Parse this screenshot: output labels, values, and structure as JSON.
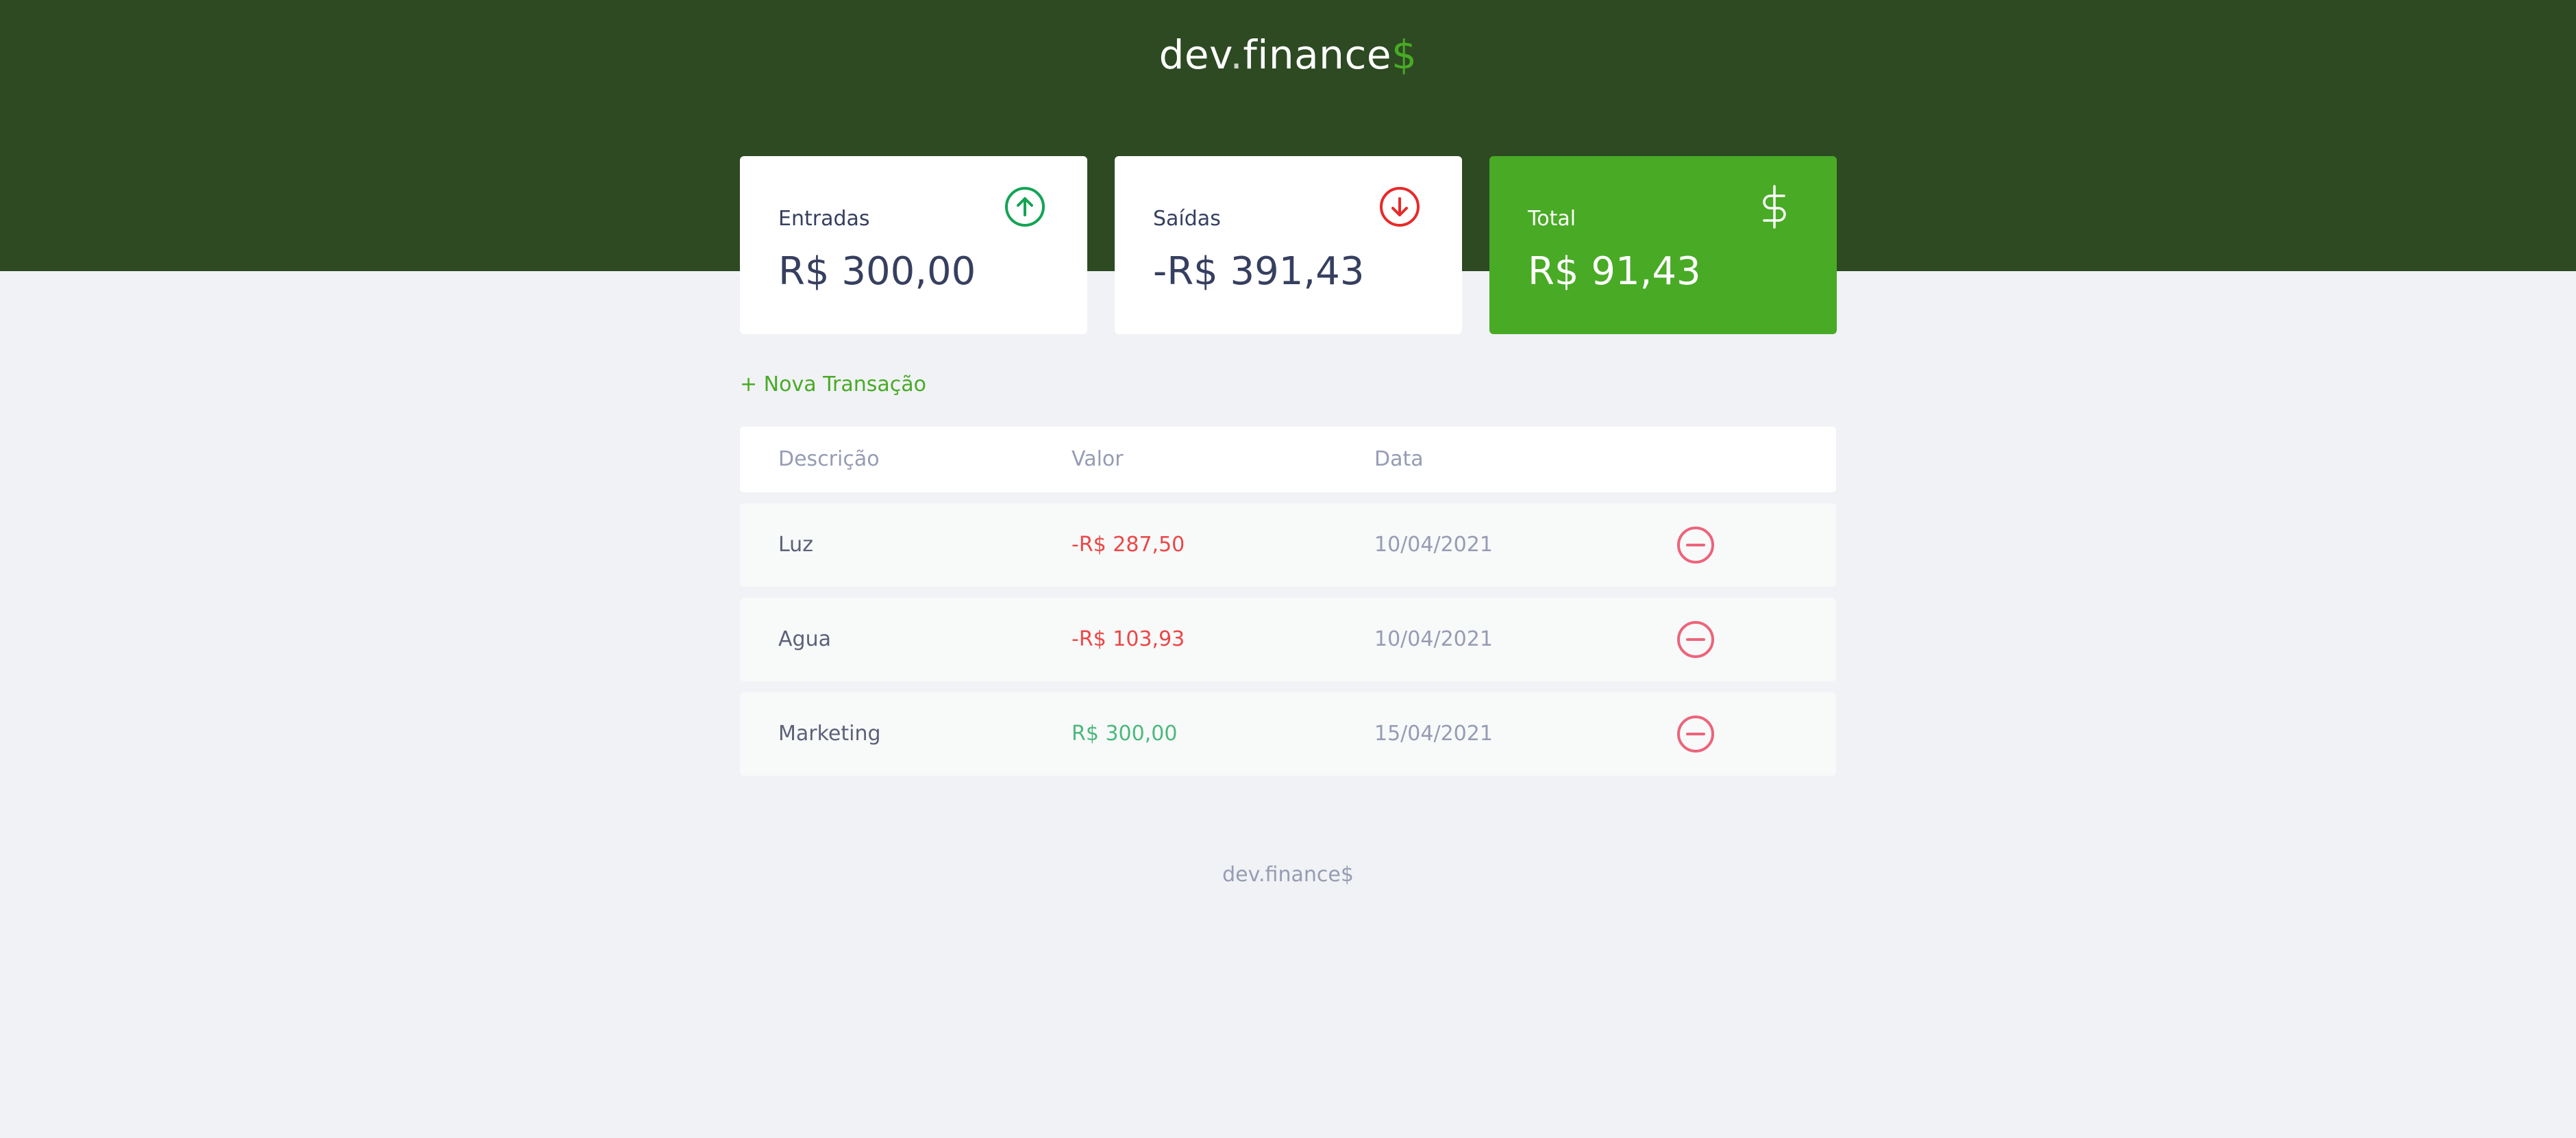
{
  "header": {
    "logo_main": "dev",
    "logo_dot": ".",
    "logo_rest": "finance",
    "logo_dollar": "$"
  },
  "cards": [
    {
      "label": "Entradas",
      "amount": "R$ 300,00",
      "icon": "arrow-up-circle-icon",
      "icon_color": "#12A454"
    },
    {
      "label": "Saídas",
      "amount": "-R$ 391,43",
      "icon": "arrow-down-circle-icon",
      "icon_color": "#E92929"
    },
    {
      "label": "Total",
      "amount": "R$ 91,43",
      "icon": "dollar-sign-icon",
      "icon_color": "#FFFFFF"
    }
  ],
  "actions": {
    "new_transaction": "+ Nova Transação"
  },
  "table": {
    "headers": [
      "Descrição",
      "Valor",
      "Data"
    ],
    "rows": [
      {
        "description": "Luz",
        "amount": "-R$ 287,50",
        "type": "expense",
        "date": "10/04/2021"
      },
      {
        "description": "Agua",
        "amount": "-R$ 103,93",
        "type": "expense",
        "date": "10/04/2021"
      },
      {
        "description": "Marketing",
        "amount": "R$ 300,00",
        "type": "income",
        "date": "15/04/2021"
      }
    ],
    "remove_icon": "minus-circle-icon"
  },
  "footer": {
    "text": "dev.finance$"
  },
  "colors": {
    "header_bg": "#2D4A22",
    "accent_green": "#49AA26",
    "page_bg": "#F0F2F5",
    "expense": "#E92929",
    "income": "#12A454",
    "text_dark": "#363F5F",
    "text_muted": "#969CB3"
  }
}
